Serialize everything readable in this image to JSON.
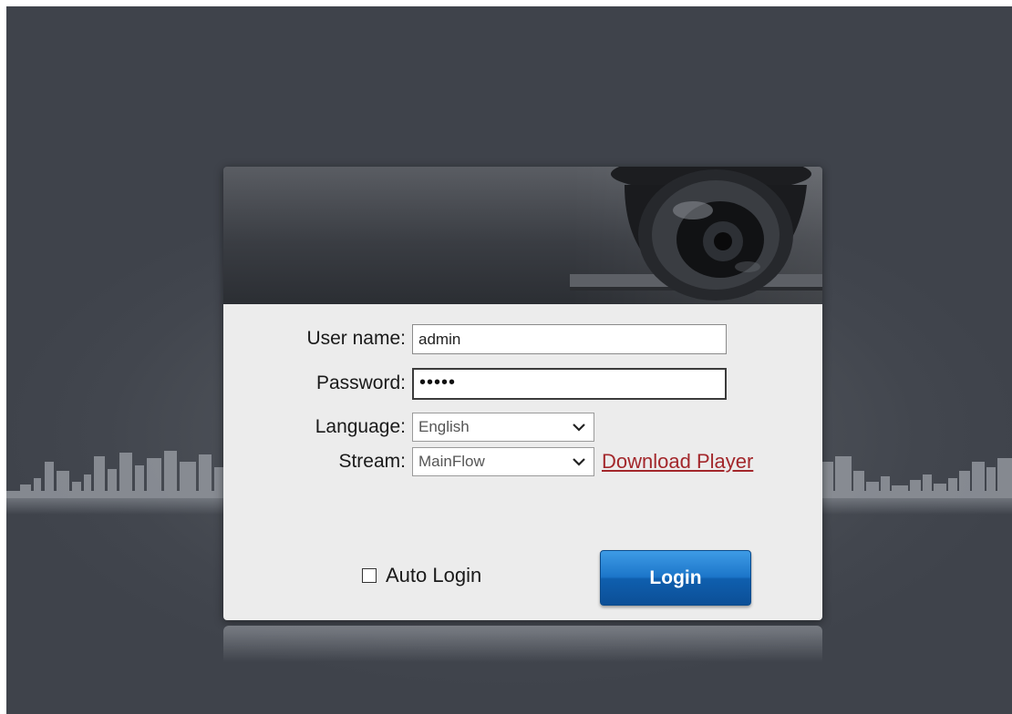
{
  "login": {
    "username_label": "User name:",
    "username_value": "admin",
    "password_label": "Password:",
    "password_value": "•••••",
    "language_label": "Language:",
    "language_value": "English",
    "stream_label": "Stream:",
    "stream_value": "MainFlow",
    "download_player": "Download Player",
    "auto_login_label": "Auto Login",
    "login_button": "Login"
  },
  "colors": {
    "background": "#42464e",
    "panel": "#ececec",
    "link": "#a3272b",
    "button": "#1c76c9"
  },
  "icons": {
    "camera": "dome-camera-icon",
    "dropdown": "chevron-down-icon"
  }
}
